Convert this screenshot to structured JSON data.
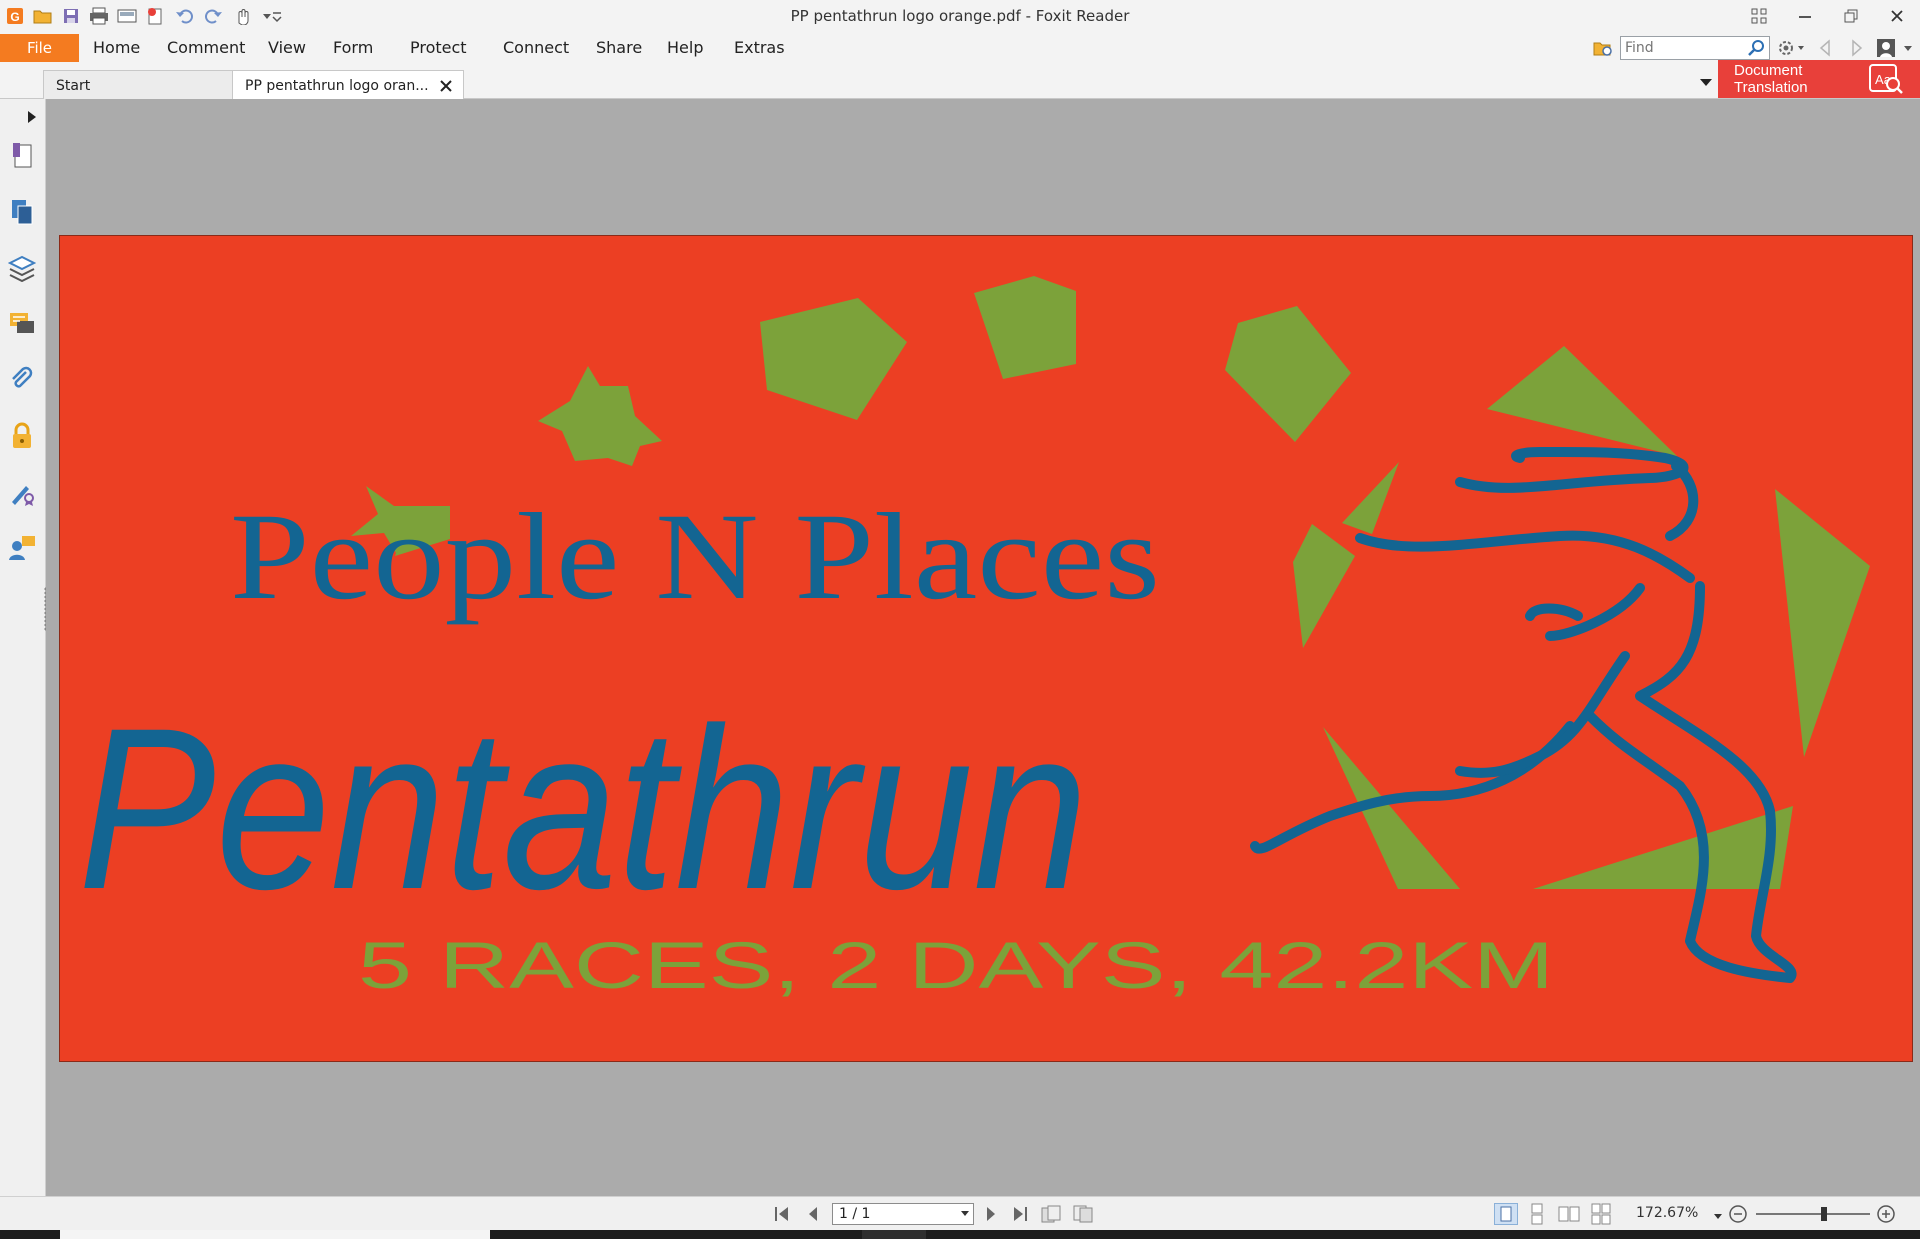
{
  "window": {
    "title": "PP pentathrun logo orange.pdf - Foxit Reader"
  },
  "menu": {
    "file": "File",
    "items": [
      "Home",
      "Comment",
      "View",
      "Form",
      "Protect",
      "Connect",
      "Share",
      "Help",
      "Extras"
    ]
  },
  "search": {
    "placeholder": "Find"
  },
  "tabs": [
    {
      "label": "Start"
    },
    {
      "label": "PP pentathrun logo oran..."
    }
  ],
  "doc_translation": {
    "line1": "Document",
    "line2": "Translation"
  },
  "document": {
    "line1": "People N Places",
    "line2": "Pentathrun",
    "line3": "5 RACES, 2 DAYS, 42.2KM",
    "colors": {
      "background": "#ec3f23",
      "blue": "#136592",
      "green": "#7ca23a"
    }
  },
  "status": {
    "page": "1 / 1",
    "zoom": "172.67%",
    "zoom_level": 0.6
  }
}
